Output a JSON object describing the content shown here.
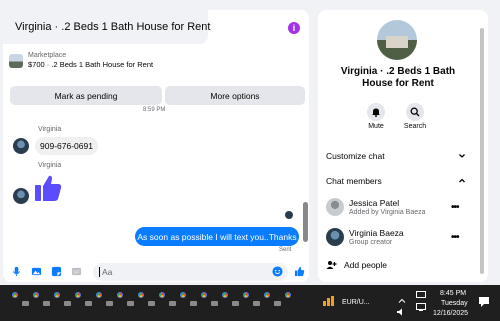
{
  "chat": {
    "title": "Virginia · .2 Beds 1 Bath House for Rent",
    "marketplace_label": "Marketplace",
    "listing_price": "$700 · .2 Beds 1 Bath House for Rent",
    "mark_pending_label": "Mark as pending",
    "more_options_label": "More options",
    "timestamp": "8:59 PM",
    "messages": [
      {
        "sender": "Virginia",
        "text": "909-676-0691"
      },
      {
        "sender": "Virginia",
        "text": "like"
      },
      {
        "sender": "me",
        "text": "As soon as possible I will text you..Thanks",
        "status": "Sent"
      }
    ],
    "composer_placeholder": "Aa"
  },
  "info": {
    "title": "Virginia · .2 Beds 1 Bath House for Rent",
    "actions": [
      {
        "label": "Mute",
        "icon": "bell-icon"
      },
      {
        "label": "Search",
        "icon": "search-icon"
      }
    ],
    "customize_label": "Customize chat",
    "members_label": "Chat members",
    "members": [
      {
        "name": "Jessica Patel",
        "subtitle": "Added by Virginia Baeza"
      },
      {
        "name": "Virginia Baeza",
        "subtitle": "Group creator"
      }
    ],
    "add_people_label": "Add people"
  },
  "taskbar": {
    "currency": "EUR/U...",
    "time": "8:45 PM",
    "day": "Tuesday",
    "date": "12/16/2025"
  },
  "colors": {
    "accent": "#0a7cff",
    "info_purple": "#a233e8",
    "taskbar_bg": "#1f1f1f"
  }
}
